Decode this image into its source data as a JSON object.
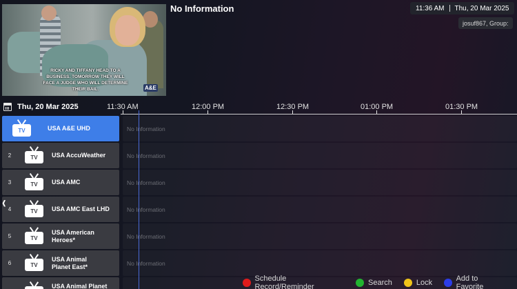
{
  "header": {
    "program_title": "No Information",
    "time": "11:36 AM",
    "date": "Thu, 20 Mar 2025",
    "user": "josuf867, Group:"
  },
  "preview": {
    "caption": "RICKY AND TIFFANY HEAD TO A BUSINESS. TOMORROW THEY WILL FACE A JUDGE WHO WILL DETERMINE THEIR BAIL.",
    "network_logo": "A&E"
  },
  "timeline": {
    "date": "Thu, 20 Mar 2025",
    "ticks": [
      "11:30 AM",
      "12:00 PM",
      "12:30 PM",
      "01:00 PM",
      "01:30 PM"
    ]
  },
  "channels": [
    {
      "number": "",
      "name": "USA A&E UHD",
      "program": "No Information",
      "selected": true
    },
    {
      "number": "2",
      "name": "USA AccuWeather",
      "program": "No Information",
      "selected": false
    },
    {
      "number": "3",
      "name": "USA AMC",
      "program": "No Information",
      "selected": false
    },
    {
      "number": "4",
      "name": "USA AMC East LHD",
      "program": "No Information",
      "selected": false
    },
    {
      "number": "5",
      "name": "USA American Heroes*",
      "program": "No Information",
      "selected": false
    },
    {
      "number": "6",
      "name": "USA Animal Planet East*",
      "program": "No Information",
      "selected": false
    },
    {
      "number": "",
      "name": "USA Animal Planet",
      "program": "",
      "selected": false
    }
  ],
  "icons": {
    "tv": "TV",
    "calendar": "calendar-icon",
    "left_arrow": "‹"
  },
  "legend": [
    {
      "label": "Schedule Record/Reminder",
      "color": "#e01b1b"
    },
    {
      "label": "Search",
      "color": "#22b531"
    },
    {
      "label": "Lock",
      "color": "#f0c419"
    },
    {
      "label": "Add to Favorite",
      "color": "#2c3de8"
    }
  ],
  "colors": {
    "selected_channel": "#3e7ee8",
    "channel_bg": "#3a3b41",
    "now_line": "#4a6ad8"
  }
}
